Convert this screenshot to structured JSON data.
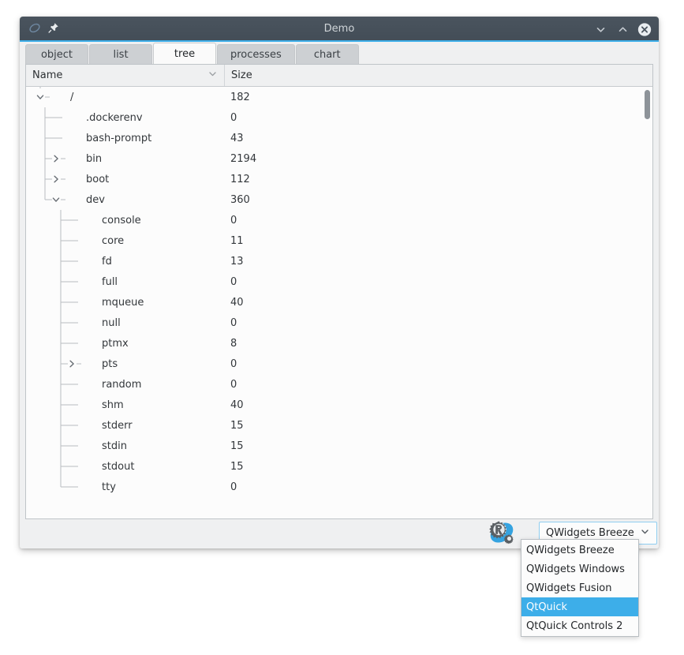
{
  "window": {
    "title": "Demo",
    "app_icon": "teardrop-icon",
    "pin_icon": "pin-icon",
    "controls": [
      {
        "name": "minimize-button",
        "icon": "chevron-down-icon"
      },
      {
        "name": "maximize-button",
        "icon": "chevron-up-icon"
      },
      {
        "name": "close-button",
        "icon": "close-circle-icon"
      }
    ]
  },
  "tabs": [
    {
      "label": "object",
      "active": false
    },
    {
      "label": "list",
      "active": false
    },
    {
      "label": "tree",
      "active": true
    },
    {
      "label": "processes",
      "active": false
    },
    {
      "label": "chart",
      "active": false
    }
  ],
  "tree": {
    "columns": [
      {
        "label": "Name",
        "sort_icon": "chevron-down-icon"
      },
      {
        "label": "Size"
      }
    ],
    "rows": [
      {
        "name": "/",
        "size": "182",
        "depth": 0,
        "state": "expanded"
      },
      {
        "name": ".dockerenv",
        "size": "0",
        "depth": 1,
        "state": "leaf"
      },
      {
        "name": "bash-prompt",
        "size": "43",
        "depth": 1,
        "state": "leaf"
      },
      {
        "name": "bin",
        "size": "2194",
        "depth": 1,
        "state": "collapsed"
      },
      {
        "name": "boot",
        "size": "112",
        "depth": 1,
        "state": "collapsed"
      },
      {
        "name": "dev",
        "size": "360",
        "depth": 1,
        "state": "expanded"
      },
      {
        "name": "console",
        "size": "0",
        "depth": 2,
        "state": "leaf"
      },
      {
        "name": "core",
        "size": "11",
        "depth": 2,
        "state": "leaf"
      },
      {
        "name": "fd",
        "size": "13",
        "depth": 2,
        "state": "leaf"
      },
      {
        "name": "full",
        "size": "0",
        "depth": 2,
        "state": "leaf"
      },
      {
        "name": "mqueue",
        "size": "40",
        "depth": 2,
        "state": "leaf"
      },
      {
        "name": "null",
        "size": "0",
        "depth": 2,
        "state": "leaf"
      },
      {
        "name": "ptmx",
        "size": "8",
        "depth": 2,
        "state": "leaf"
      },
      {
        "name": "pts",
        "size": "0",
        "depth": 2,
        "state": "collapsed"
      },
      {
        "name": "random",
        "size": "0",
        "depth": 2,
        "state": "leaf"
      },
      {
        "name": "shm",
        "size": "40",
        "depth": 2,
        "state": "leaf"
      },
      {
        "name": "stderr",
        "size": "15",
        "depth": 2,
        "state": "leaf"
      },
      {
        "name": "stdin",
        "size": "15",
        "depth": 2,
        "state": "leaf"
      },
      {
        "name": "stdout",
        "size": "15",
        "depth": 2,
        "state": "leaf"
      },
      {
        "name": "tty",
        "size": "0",
        "depth": 2,
        "state": "leaf"
      }
    ]
  },
  "bottom": {
    "logo_icon": "rust-gear-logo-icon",
    "style_combo": {
      "value": "QWidgets Breeze",
      "arrow_icon": "chevron-down-icon",
      "options": [
        {
          "label": "QWidgets Breeze",
          "selected": false
        },
        {
          "label": "QWidgets Windows",
          "selected": false
        },
        {
          "label": "QWidgets Fusion",
          "selected": false
        },
        {
          "label": "QtQuick",
          "selected": true
        },
        {
          "label": "QtQuick Controls 2",
          "selected": false
        }
      ]
    }
  },
  "colors": {
    "titlebar": "#434d57",
    "accent": "#3daee9",
    "panel": "#eff0f1",
    "view_bg": "#fcfcfc",
    "text": "#232629"
  }
}
